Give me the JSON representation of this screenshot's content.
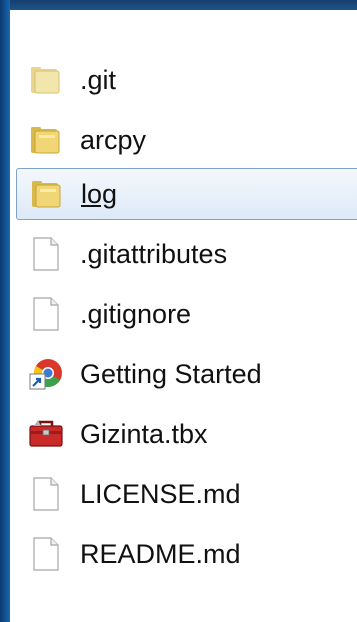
{
  "colors": {
    "frame": "#1b67b0",
    "selection_border": "#7da2ce",
    "selection_fill": "#dde9f7"
  },
  "files": [
    {
      "label": ".git",
      "icon": "folder-icon",
      "selected": false
    },
    {
      "label": "arcpy",
      "icon": "folder-icon",
      "selected": false
    },
    {
      "label": "log",
      "icon": "folder-icon",
      "selected": true
    },
    {
      "label": ".gitattributes",
      "icon": "file-icon",
      "selected": false
    },
    {
      "label": ".gitignore",
      "icon": "file-icon",
      "selected": false
    },
    {
      "label": "Getting Started",
      "icon": "chrome-shortcut-icon",
      "selected": false
    },
    {
      "label": "Gizinta.tbx",
      "icon": "toolbox-icon",
      "selected": false
    },
    {
      "label": "LICENSE.md",
      "icon": "file-icon",
      "selected": false
    },
    {
      "label": "README.md",
      "icon": "file-icon",
      "selected": false
    }
  ]
}
